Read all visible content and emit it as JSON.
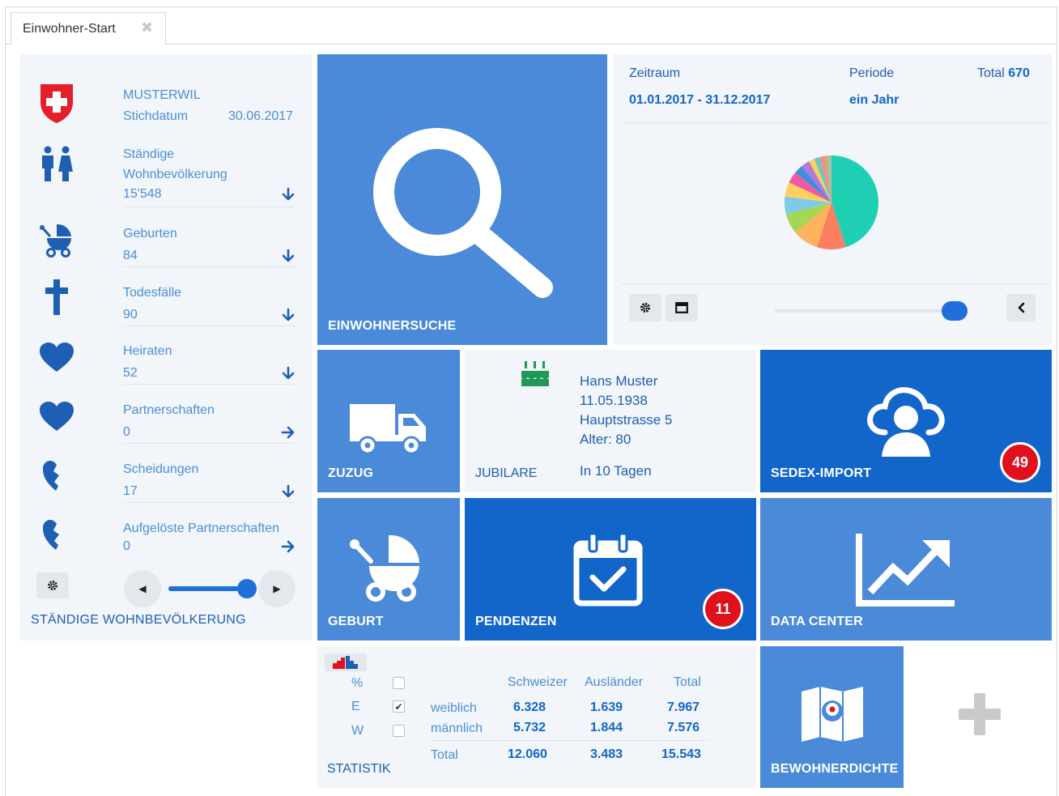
{
  "tab": {
    "title": "Einwohner-Start",
    "close_glyph": "✖"
  },
  "left": {
    "commune": "MUSTERWIL",
    "reference_label": "Stichdatum",
    "reference_date": "30.06.2017",
    "rows": [
      {
        "label1": "Ständige",
        "label2": "Wohnbevölkerung",
        "value": "15'548",
        "icon": "people-icon",
        "arrow": "down"
      },
      {
        "label1": "Geburten",
        "value": "84",
        "icon": "stroller-icon",
        "arrow": "down"
      },
      {
        "label1": "Todesfälle",
        "value": "90",
        "icon": "cross-icon",
        "arrow": "down"
      },
      {
        "label1": "Heiraten",
        "value": "52",
        "icon": "heart-icon",
        "arrow": "down"
      },
      {
        "label1": "Partnerschaften",
        "value": "0",
        "icon": "heart-icon",
        "arrow": "right"
      },
      {
        "label1": "Scheidungen",
        "value": "17",
        "icon": "broken-heart-icon",
        "arrow": "down"
      },
      {
        "label1": "Aufgelöste Partnerschaften",
        "value": "0",
        "icon": "broken-heart-icon",
        "arrow": "right"
      }
    ],
    "footer": "STÄNDIGE WOHNBEVÖLKERUNG",
    "slider_level": 1.0
  },
  "search_tile": {
    "label": "EINWOHNERSUCHE"
  },
  "chart_panel": {
    "period_label": "Zeitraum",
    "period_value": "01.01.2017 - 31.12.2017",
    "periode_label": "Periode",
    "periode_value": "ein Jahr",
    "total_label": "Total",
    "total_value": "670",
    "slider_level": 1.0
  },
  "chart_data": {
    "type": "pie",
    "values": [
      45,
      10,
      9,
      7,
      6,
      5,
      4,
      3,
      3,
      2,
      2,
      2,
      1,
      1
    ],
    "colors": [
      "#1ecfb4",
      "#fa7f62",
      "#fdb25e",
      "#a4d756",
      "#7ecbe8",
      "#ffcf60",
      "#ef5aa0",
      "#3f8ee0",
      "#b17ad9",
      "#f6d35a",
      "#6fc7c0",
      "#ff8a8a",
      "#96d05a",
      "#b0b8c4"
    ]
  },
  "zuzug": {
    "label": "ZUZUG"
  },
  "jubilare": {
    "label": "JUBILARE",
    "name": "Hans Muster",
    "birthdate": "11.05.1938",
    "street": "Hauptstrasse 5",
    "age": "Alter: 80",
    "in_days": "In 10 Tagen"
  },
  "sedex": {
    "label": "SEDEX-IMPORT",
    "badge": "49"
  },
  "geburt": {
    "label": "GEBURT"
  },
  "pendenzen": {
    "label": "PENDENZEN",
    "badge": "11"
  },
  "datacenter": {
    "label": "DATA CENTER"
  },
  "statistik": {
    "label": "STATISTIK",
    "options": [
      {
        "key": "%",
        "checked": false
      },
      {
        "key": "E",
        "checked": true
      },
      {
        "key": "W",
        "checked": false
      }
    ],
    "checkmark": "✔",
    "headers": [
      "Schweizer",
      "Ausländer",
      "Total"
    ],
    "rows": [
      {
        "label": "weiblich",
        "values": [
          "6.328",
          "1.639",
          "7.967"
        ]
      },
      {
        "label": "männlich",
        "values": [
          "5.732",
          "1.844",
          "7.576"
        ]
      }
    ],
    "total_label": "Total",
    "totals": [
      "12.060",
      "3.483",
      "15.543"
    ]
  },
  "bewohnerdichte": {
    "label": "BEWOHNERDICHTE"
  },
  "colors": {
    "tile": "#4a8ad8",
    "tile_dark": "#1266c9",
    "panel": "#f2f5f9",
    "badge": "#e0101d",
    "accent": "#1f5fb3"
  }
}
